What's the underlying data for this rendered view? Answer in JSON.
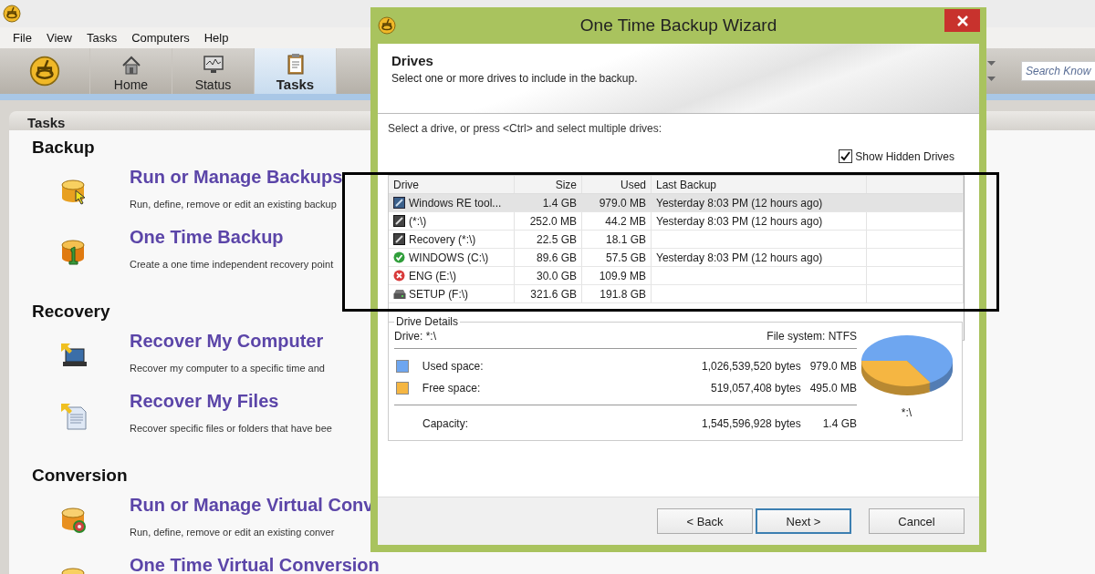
{
  "app": {
    "menu": [
      "File",
      "View",
      "Tasks",
      "Computers",
      "Help"
    ],
    "toolbar_tabs": [
      {
        "label": "Home",
        "selected": false
      },
      {
        "label": "Status",
        "selected": false
      },
      {
        "label": "Tasks",
        "selected": true
      }
    ],
    "search": {
      "placeholder": "Search Know"
    },
    "panel_title": "Tasks",
    "sections": [
      {
        "heading": "Backup",
        "items": [
          {
            "kind": "manage-backup",
            "title": "Run or Manage Backups",
            "description": "Run, define, remove or edit an existing backup"
          },
          {
            "kind": "one-time-backup",
            "title": "One Time Backup",
            "description": "Create a one time independent recovery point"
          }
        ]
      },
      {
        "heading": "Recovery",
        "items": [
          {
            "kind": "recover-computer",
            "title": "Recover My Computer",
            "description": "Recover my computer to a specific time and"
          },
          {
            "kind": "recover-files",
            "title": "Recover My Files",
            "description": "Recover specific files or folders that have bee"
          }
        ]
      },
      {
        "heading": "Conversion",
        "items": [
          {
            "kind": "manage-virtual",
            "title": "Run or Manage Virtual Conv",
            "description": "Run, define, remove or edit an existing conver"
          },
          {
            "kind": "one-time-virtual",
            "title": "One Time Virtual Conversion"
          }
        ]
      }
    ]
  },
  "dialog": {
    "title": "One Time Backup Wizard",
    "header_title": "Drives",
    "header_subtitle": "Select one or more drives to include in the backup.",
    "instruction": "Select a drive, or press <Ctrl> and select multiple drives:",
    "show_hidden": {
      "label": "Show Hidden Drives",
      "checked": true
    },
    "table": {
      "columns": [
        "Drive",
        "Size",
        "Used",
        "Last Backup"
      ],
      "rows": [
        {
          "kind": "volume",
          "drive": "Windows RE tool...",
          "size": "1.4 GB",
          "used": "979.0 MB",
          "last_backup": "Yesterday 8:03 PM (12 hours ago)",
          "selected": true
        },
        {
          "kind": "hidden",
          "drive": "(*:\\)",
          "size": "252.0 MB",
          "used": "44.2 MB",
          "last_backup": "Yesterday 8:03 PM (12 hours ago)",
          "selected": false
        },
        {
          "kind": "hidden",
          "drive": "Recovery (*:\\)",
          "size": "22.5 GB",
          "used": "18.1 GB",
          "selected": false
        },
        {
          "kind": "ok",
          "drive": "WINDOWS (C:\\)",
          "size": "89.6 GB",
          "used": "57.5 GB",
          "last_backup": "Yesterday 8:03 PM (12 hours ago)",
          "selected": false
        },
        {
          "kind": "error",
          "drive": "ENG (E:\\)",
          "size": "30.0 GB",
          "used": "109.9 MB",
          "selected": false
        },
        {
          "kind": "removable",
          "drive": "SETUP (F:\\)",
          "size": "321.6 GB",
          "used": "191.8 GB",
          "selected": false
        }
      ]
    },
    "details": {
      "title": "Drive Details",
      "drive": "Drive: *:\\",
      "file_system": "File system: NTFS",
      "rows": [
        {
          "label": "Used space:",
          "color": "#6ea6f0",
          "bytes": "1,026,539,520 bytes",
          "size": "979.0 MB"
        },
        {
          "label": "Free space:",
          "color": "#f5b642",
          "bytes": "519,057,408 bytes",
          "size": "495.0 MB"
        }
      ],
      "capacity": {
        "label": "Capacity:",
        "bytes": "1,545,596,928 bytes",
        "size": "1.4 GB"
      },
      "pie_label": "*:\\"
    },
    "buttons": [
      {
        "label": "< Back",
        "default": false
      },
      {
        "label": "Next >",
        "default": true
      },
      {
        "label": "Cancel",
        "default": false
      }
    ]
  }
}
